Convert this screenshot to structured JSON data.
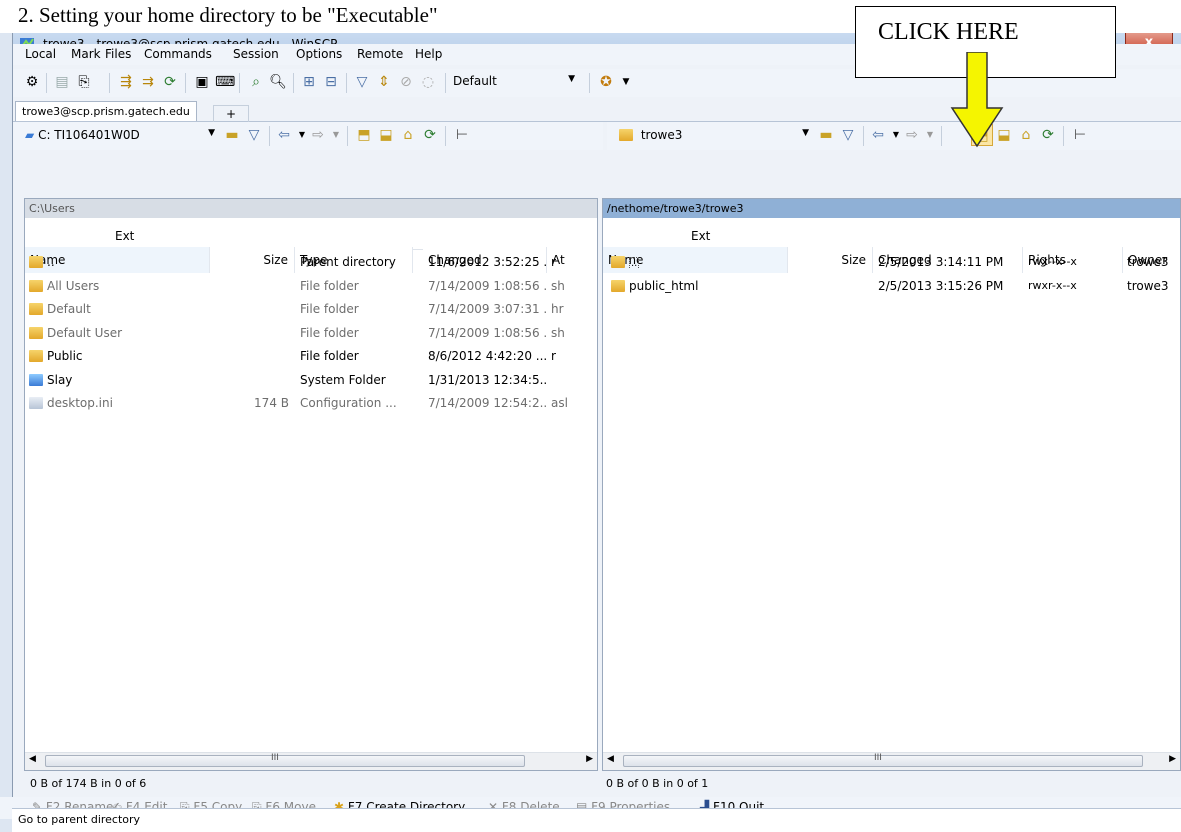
{
  "doc_title": "2. Setting your home directory to be \"Executable\"",
  "callout": {
    "text": "CLICK HERE"
  },
  "window": {
    "title": "trowe3 - trowe3@scp.prism.gatech.edu - WinSCP",
    "close_label": "x"
  },
  "menu": [
    "Local",
    "Mark",
    "Files",
    "Commands",
    "Session",
    "Options",
    "Remote",
    "Help"
  ],
  "toolbar": {
    "profile_combo": "Default"
  },
  "tabs": {
    "session": "trowe3@scp.prism.gatech.edu",
    "new_tab": "+"
  },
  "left_panel": {
    "drive": "C: TI106401W0D",
    "path": "C:\\Users",
    "columns": [
      "Name",
      "Ext",
      "Size",
      "Type",
      "Changed",
      "At"
    ],
    "rows": [
      {
        "name": "..",
        "size": "",
        "type": "Parent directory",
        "changed": "11/6/2012 3:52:25 ...",
        "attr": "r",
        "dim": false
      },
      {
        "name": "All Users",
        "size": "",
        "type": "File folder",
        "changed": "7/14/2009 1:08:56 ...",
        "attr": "sh",
        "dim": true
      },
      {
        "name": "Default",
        "size": "",
        "type": "File folder",
        "changed": "7/14/2009 3:07:31 ...",
        "attr": "hr",
        "dim": true
      },
      {
        "name": "Default User",
        "size": "",
        "type": "File folder",
        "changed": "7/14/2009 1:08:56 ...",
        "attr": "sh",
        "dim": true
      },
      {
        "name": "Public",
        "size": "",
        "type": "File folder",
        "changed": "8/6/2012 4:42:20 ...",
        "attr": "r",
        "dim": false
      },
      {
        "name": "Slay",
        "size": "",
        "type": "System Folder",
        "changed": "1/31/2013 12:34:5...",
        "attr": "",
        "dim": false
      },
      {
        "name": "desktop.ini",
        "size": "174 B",
        "type": "Configuration ...",
        "changed": "7/14/2009 12:54:2...",
        "attr": "asl",
        "dim": true
      }
    ],
    "status": "0 B of 174 B in 0 of 6"
  },
  "right_panel": {
    "folder": "trowe3",
    "path": "/nethome/trowe3/trowe3",
    "columns": [
      "Name",
      "Ext",
      "Size",
      "Changed",
      "Rights",
      "Owner"
    ],
    "rows": [
      {
        "name": "..",
        "changed": "2/5/2013 3:14:11 PM",
        "rights": "rwx--x--x",
        "owner": "trowe3"
      },
      {
        "name": "public_html",
        "changed": "2/5/2013 3:15:26 PM",
        "rights": "rwxr-x--x",
        "owner": "trowe3"
      }
    ],
    "status": "0 B of 0 B in 0 of 1"
  },
  "scroll_mark": "III",
  "fkeys": [
    "F2 Rename",
    "F4 Edit",
    "F5 Copy",
    "F6 Move",
    "F7 Create Directory",
    "F8 Delete",
    "F9 Properties",
    "F10 Quit"
  ],
  "bottom_status": "Go to parent directory",
  "colors": {
    "arrow": "#f5f500",
    "pane_header_left": "#d7dde5",
    "pane_header_right": "#8fb0d6"
  }
}
